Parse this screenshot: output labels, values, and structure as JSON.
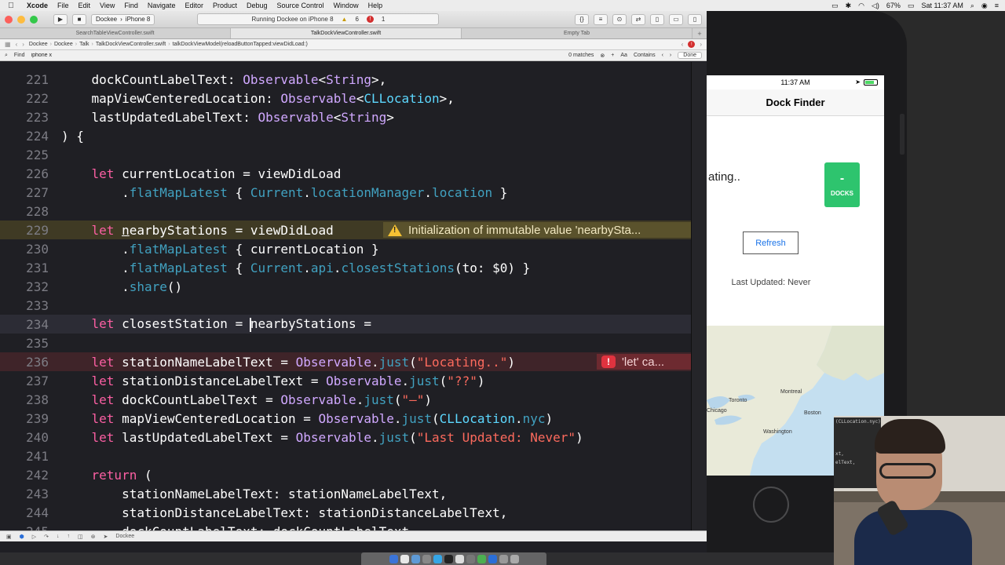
{
  "menubar": {
    "app": "Xcode",
    "items": [
      "File",
      "Edit",
      "View",
      "Find",
      "Navigate",
      "Editor",
      "Product",
      "Debug",
      "Source Control",
      "Window",
      "Help"
    ],
    "battery": "67%",
    "clock": "Sat 11:37 AM"
  },
  "toolbar": {
    "scheme": "Dockee",
    "device": "iPhone 8",
    "activity": "Running Dockee on iPhone 8",
    "warnings": "6",
    "errors": "1"
  },
  "tabs": [
    "SearchTableViewController.swift",
    "TalkDockViewController.swift",
    "Empty Tab"
  ],
  "jumpbar": {
    "crumbs": [
      "Dockee",
      "Dockee",
      "Talk",
      "TalkDockViewController.swift",
      "talkDockViewModel(reloadButtonTapped:viewDidLoad:)"
    ]
  },
  "findbar": {
    "label": "Find",
    "query": "iphone x",
    "matches": "0 matches",
    "option_aa": "Aa",
    "mode": "Contains",
    "done": "Done"
  },
  "editor": {
    "lines": [
      {
        "n": "221",
        "html": "    dockCountLabelText: <span class='ty'>Observable</span>&lt;<span class='ty'>String</span>&gt;,"
      },
      {
        "n": "222",
        "html": "    mapViewCenteredLocation: <span class='ty'>Observable</span>&lt;<span class='tp'>CLLocation</span>&gt;,"
      },
      {
        "n": "223",
        "html": "    lastUpdatedLabelText: <span class='ty'>Observable</span>&lt;<span class='ty'>String</span>&gt;"
      },
      {
        "n": "224",
        "html": ") {"
      },
      {
        "n": "225",
        "html": ""
      },
      {
        "n": "226",
        "html": "    <span class='kw'>let</span> currentLocation = viewDidLoad"
      },
      {
        "n": "227",
        "html": "        .<span class='lx'>flatMapLatest</span> { <span class='lx'>Current</span>.<span class='lx'>locationManager</span>.<span class='lx'>location</span> }"
      },
      {
        "n": "228",
        "html": ""
      },
      {
        "n": "229",
        "html": "    <span class='kw'>let</span> <u>n</u>earbyStations = viewDidLoad",
        "cls": "warn"
      },
      {
        "n": "230",
        "html": "        .<span class='lx'>flatMapLatest</span> { currentLocation }"
      },
      {
        "n": "231",
        "html": "        .<span class='lx'>flatMapLatest</span> { <span class='lx'>Current</span>.<span class='lx'>api</span>.<span class='lx'>closestStations</span>(to: $0) }"
      },
      {
        "n": "232",
        "html": "        .<span class='lx'>share</span>()"
      },
      {
        "n": "233",
        "html": ""
      },
      {
        "n": "234",
        "html": "    <span class='kw'>let</span> closestStation = <span class='caret'></span>nearbyStations =",
        "cls": "cur"
      },
      {
        "n": "235",
        "html": ""
      },
      {
        "n": "236",
        "html": "    <span class='kw'>let</span> stationNameLabelText = <span class='ty'>Observable</span>.<span class='lx'>just</span>(<span class='st'>\"Locating..\"</span>)",
        "cls": "err"
      },
      {
        "n": "237",
        "html": "    <span class='kw'>let</span> stationDistanceLabelText = <span class='ty'>Observable</span>.<span class='lx'>just</span>(<span class='st'>\"??\"</span>)"
      },
      {
        "n": "238",
        "html": "    <span class='kw'>let</span> dockCountLabelText = <span class='ty'>Observable</span>.<span class='lx'>just</span>(<span class='st'>\"–\"</span>)"
      },
      {
        "n": "239",
        "html": "    <span class='kw'>let</span> mapViewCenteredLocation = <span class='ty'>Observable</span>.<span class='lx'>just</span>(<span class='tp'>CLLocation</span>.<span class='lx'>nyc</span>)"
      },
      {
        "n": "240",
        "html": "    <span class='kw'>let</span> lastUpdatedLabelText = <span class='ty'>Observable</span>.<span class='lx'>just</span>(<span class='st'>\"Last Updated: Never\"</span>)"
      },
      {
        "n": "241",
        "html": ""
      },
      {
        "n": "242",
        "html": "    <span class='kw'>return</span> ("
      },
      {
        "n": "243",
        "html": "        stationNameLabelText: stationNameLabelText,"
      },
      {
        "n": "244",
        "html": "        stationDistanceLabelText: stationDistanceLabelText,"
      },
      {
        "n": "245",
        "html": "        dockCountLabelText: dockCountLabelText,"
      }
    ],
    "warning_message": "Initialization of immutable value 'nearbySta...",
    "error_message": "'let' ca..."
  },
  "debugbar": {
    "target": "Dockee"
  },
  "simulator": {
    "time": "11:37 AM",
    "nav_title": "Dock Finder",
    "station_label": "ating..",
    "dock_count": "-",
    "dock_label": "DOCKS",
    "refresh_button": "Refresh",
    "last_updated": "Last Updated: Never",
    "map_cities": [
      "Montreal",
      "Toronto",
      "Boston",
      "Washington",
      "Chicago"
    ]
  },
  "webcam": {
    "code_fragments": [
      "(CLLocation.nyc)",
      "xt,",
      "elText,"
    ]
  }
}
